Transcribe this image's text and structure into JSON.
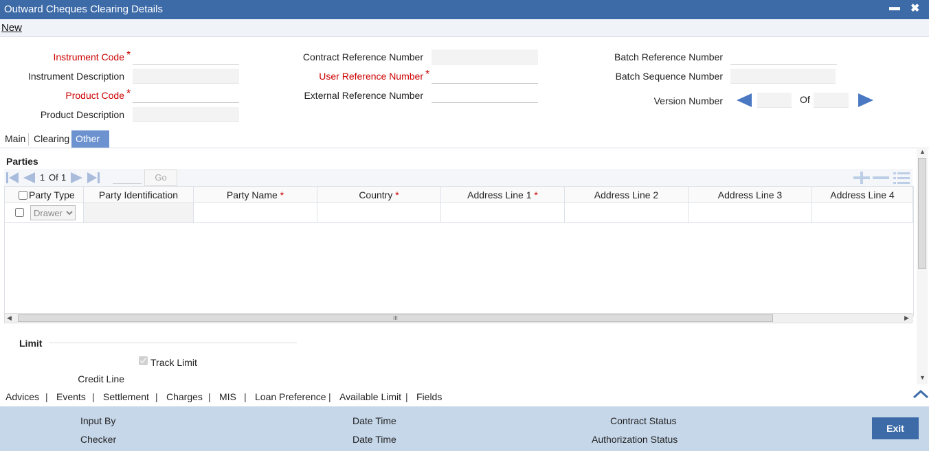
{
  "window": {
    "title": "Outward Cheques Clearing Details",
    "minimize": "▬",
    "close": "✖"
  },
  "menu": {
    "new_label": "New"
  },
  "header_fields": {
    "instrument_code": {
      "label": "Instrument Code",
      "value": ""
    },
    "instrument_description": {
      "label": "Instrument Description",
      "value": ""
    },
    "product_code": {
      "label": "Product Code",
      "value": ""
    },
    "product_description": {
      "label": "Product Description",
      "value": ""
    },
    "contract_reference_number": {
      "label": "Contract Reference Number",
      "value": ""
    },
    "user_reference_number": {
      "label": "User Reference Number",
      "value": ""
    },
    "external_reference_number": {
      "label": "External Reference Number",
      "value": ""
    },
    "batch_reference_number": {
      "label": "Batch Reference Number",
      "value": ""
    },
    "batch_sequence_number": {
      "label": "Batch Sequence Number",
      "value": ""
    },
    "version_number": {
      "label": "Version Number",
      "of_label": "Of",
      "current": "",
      "total": ""
    },
    "required_marker": "*"
  },
  "tabs": [
    {
      "label": "Main",
      "active": false
    },
    {
      "label": "Clearing",
      "active": false
    },
    {
      "label": "Other Details",
      "active": true
    }
  ],
  "parties": {
    "title": "Parties",
    "pager": {
      "current": "1",
      "of_label": "Of",
      "total": "1",
      "go_label": "Go"
    },
    "columns": [
      {
        "label": "Party Type",
        "required": false
      },
      {
        "label": "Party Identification",
        "required": false
      },
      {
        "label": "Party Name",
        "required": true
      },
      {
        "label": "Country",
        "required": true
      },
      {
        "label": "Address Line 1",
        "required": true
      },
      {
        "label": "Address Line 2",
        "required": false
      },
      {
        "label": "Address Line 3",
        "required": false
      },
      {
        "label": "Address Line 4",
        "required": false
      }
    ],
    "rows": [
      {
        "party_type": "Drawer",
        "party_identification": "",
        "party_name": "",
        "country": "",
        "address_line_1": "",
        "address_line_2": "",
        "address_line_3": "",
        "address_line_4": ""
      }
    ],
    "scroll_mark": "III"
  },
  "limit": {
    "title": "Limit",
    "track_limit_label": "Track Limit",
    "track_limit_checked": true,
    "credit_line_label": "Credit Line"
  },
  "bottom_nav": [
    "Advices",
    "Events",
    "Settlement",
    "Charges",
    "MIS",
    "Loan Preference",
    "Available Limit",
    "Fields"
  ],
  "footer": {
    "input_by": "Input By",
    "checker": "Checker",
    "date_time_1": "Date Time",
    "date_time_2": "Date Time",
    "contract_status": "Contract Status",
    "authorization_status": "Authorization Status",
    "exit_label": "Exit"
  },
  "colors": {
    "title_bar": "#3d6ba8",
    "active_tab": "#6c93cf",
    "required": "#cc0000",
    "footer": "#c6d7ea",
    "nav_arrow": "#4a78c2"
  }
}
